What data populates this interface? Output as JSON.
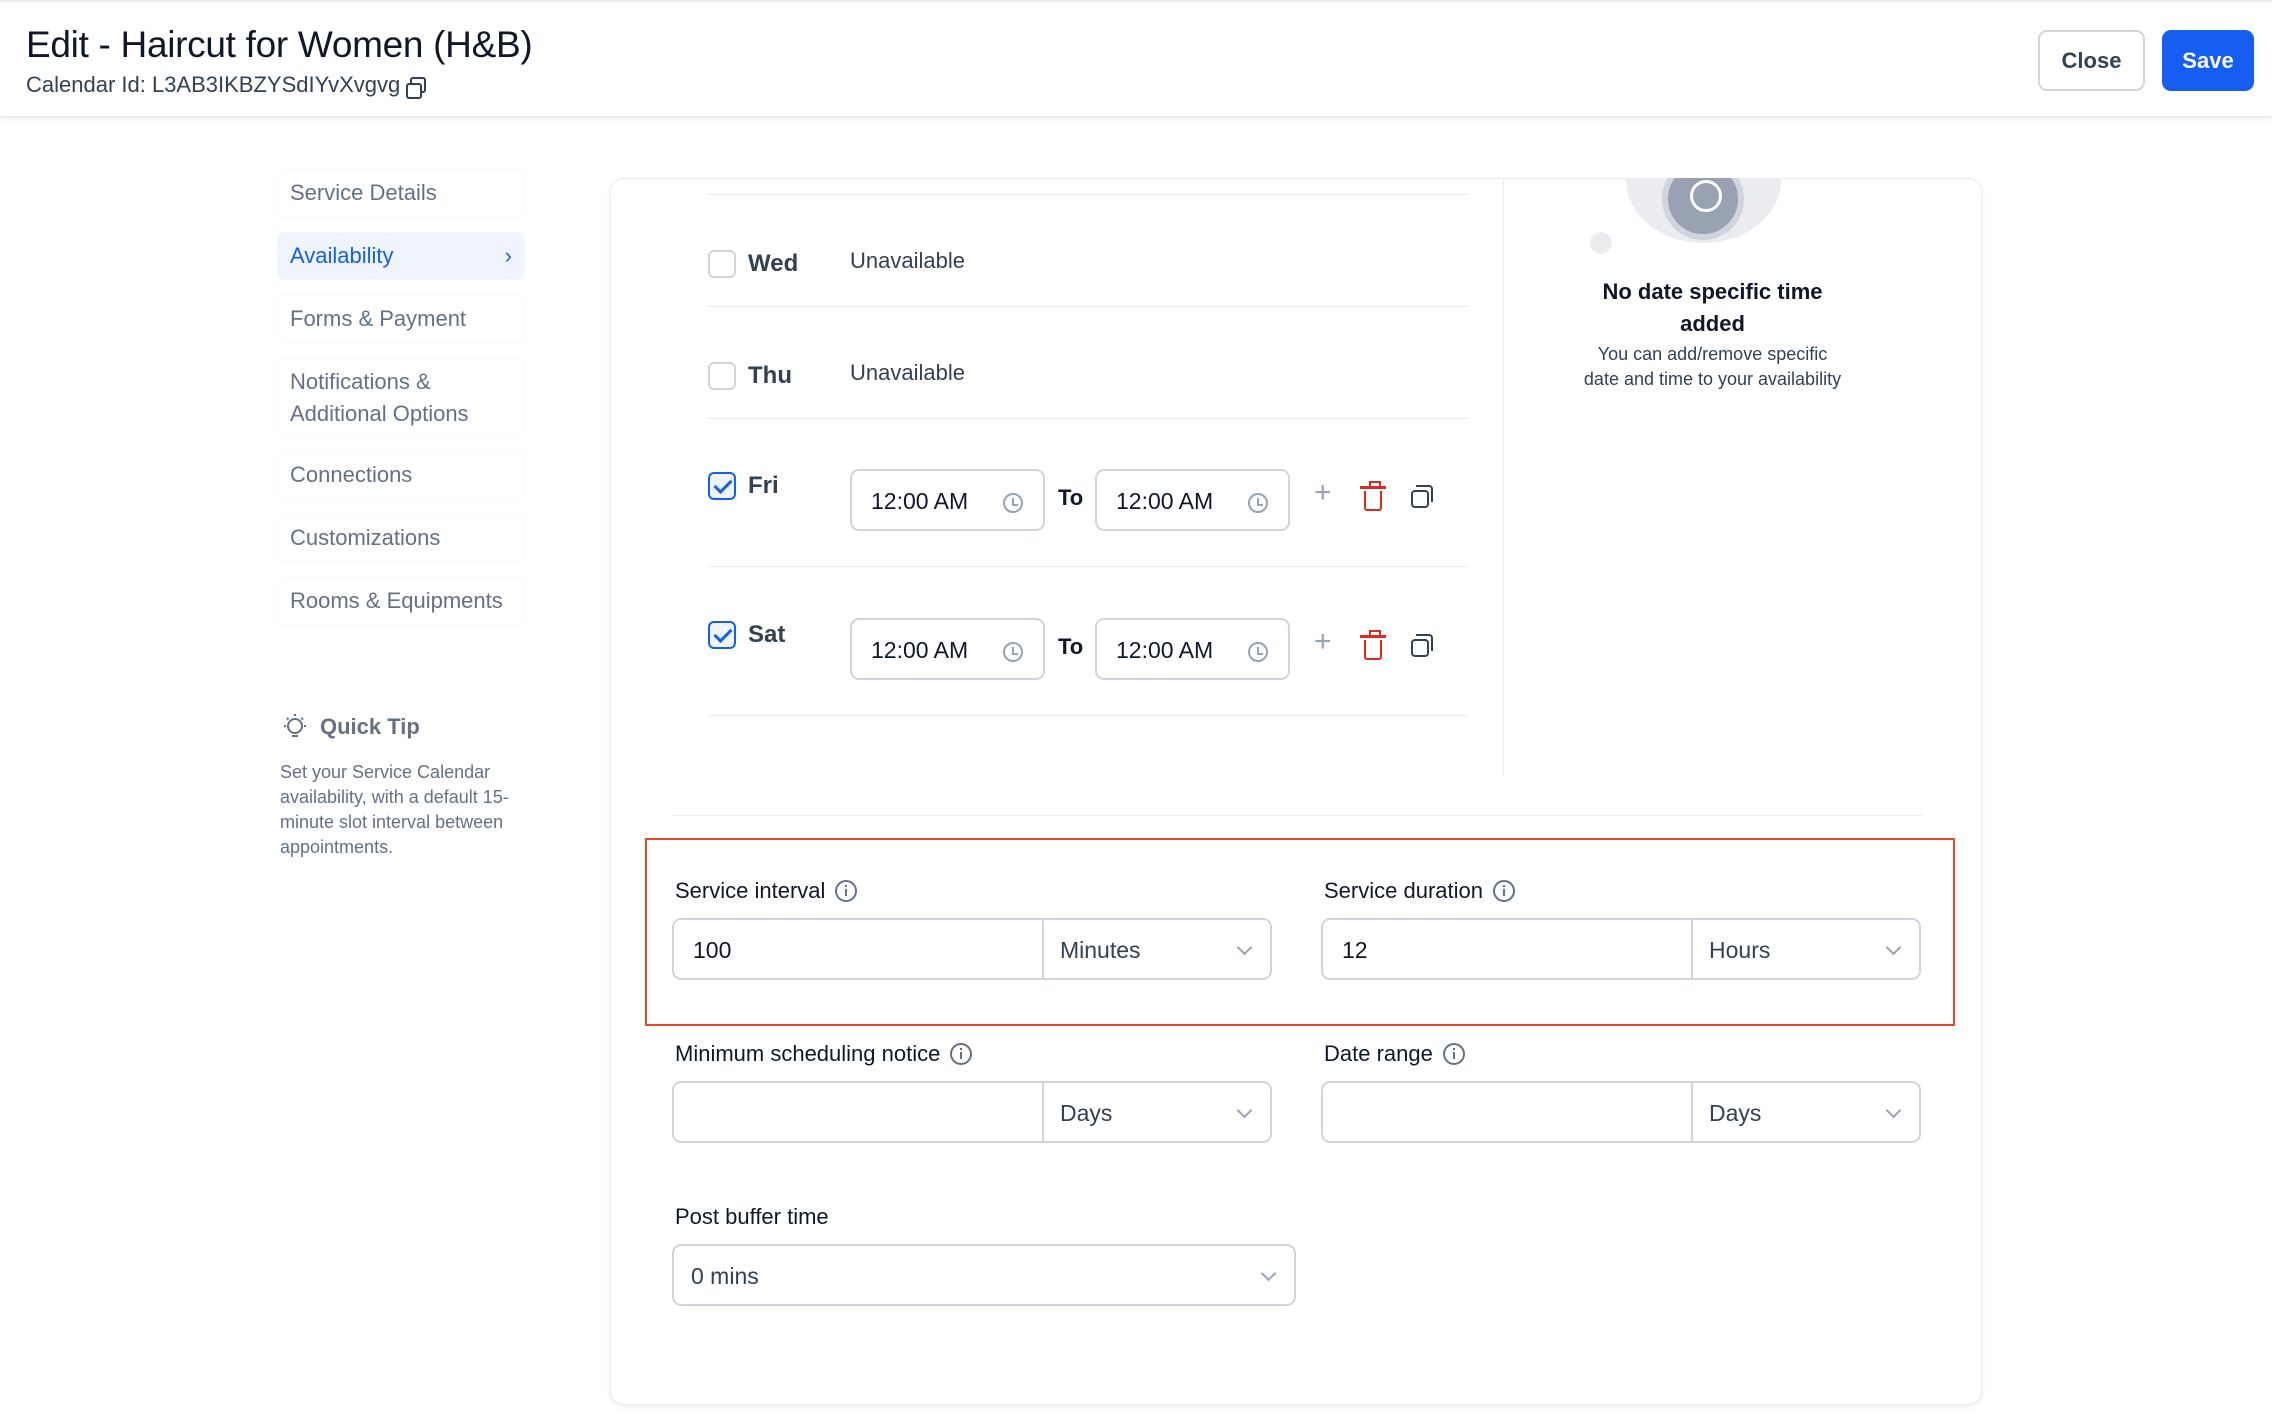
{
  "header": {
    "title": "Edit - Haircut for Women (H&B)",
    "calendar_id_label": "Calendar Id: L3AB3IKBZYSdIYvXvgvg",
    "close_label": "Close",
    "save_label": "Save"
  },
  "sidebar": {
    "items": [
      {
        "label": "Service Details"
      },
      {
        "label": "Availability",
        "active": true
      },
      {
        "label": "Forms & Payment"
      },
      {
        "label": "Notifications & Additional Options"
      },
      {
        "label": "Connections"
      },
      {
        "label": "Customizations"
      },
      {
        "label": "Rooms & Equipments"
      }
    ],
    "quick_tip": {
      "title": "Quick Tip",
      "text": "Set your Service Calendar availability, with a default 15-minute slot interval between appointments."
    }
  },
  "availability": {
    "days": [
      {
        "name": "Wed",
        "checked": false,
        "status": "Unavailable"
      },
      {
        "name": "Thu",
        "checked": false,
        "status": "Unavailable"
      },
      {
        "name": "Fri",
        "checked": true,
        "from": "12:00 AM",
        "to_label": "To",
        "to": "12:00 AM"
      },
      {
        "name": "Sat",
        "checked": true,
        "from": "12:00 AM",
        "to_label": "To",
        "to": "12:00 AM"
      }
    ]
  },
  "date_specific": {
    "title": "No date specific time added",
    "text": "You can add/remove specific date and time to your availability"
  },
  "settings": {
    "service_interval": {
      "label": "Service interval",
      "value": "100",
      "unit": "Minutes"
    },
    "service_duration": {
      "label": "Service duration",
      "value": "12",
      "unit": "Hours"
    },
    "min_notice": {
      "label": "Minimum scheduling notice",
      "value": "",
      "unit": "Days"
    },
    "date_range": {
      "label": "Date range",
      "value": "",
      "unit": "Days"
    },
    "post_buffer": {
      "label": "Post buffer time",
      "value": "0 mins"
    }
  },
  "colors": {
    "accent": "#155eef",
    "highlight": "#e8472a",
    "danger": "#d92d20"
  }
}
